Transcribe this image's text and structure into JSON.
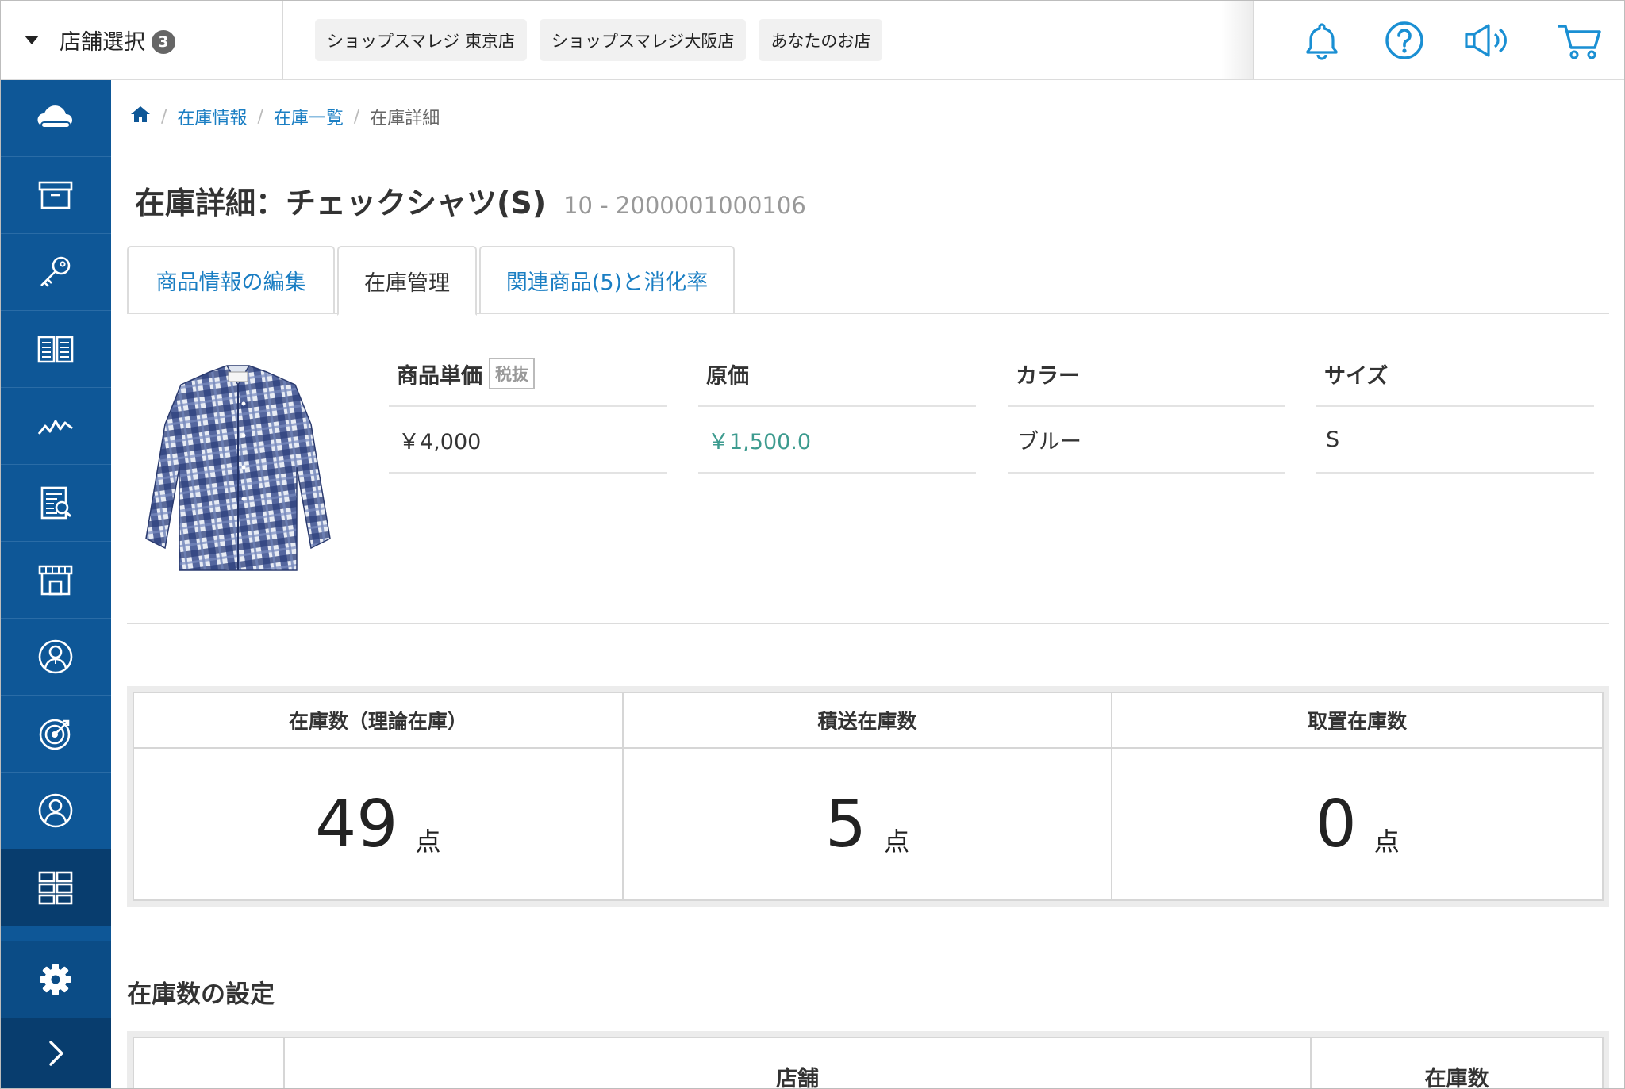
{
  "header": {
    "store_select_label": "店舗選択",
    "store_count": "3",
    "shop_tabs": [
      "ショップスマレジ 東京店",
      "ショップスマレジ大阪店",
      "あなたのお店"
    ],
    "icons": [
      "bell-icon",
      "help-icon",
      "megaphone-icon",
      "cart-icon"
    ]
  },
  "sidebar": {
    "icons": [
      "cloud-icon",
      "archive-box-icon",
      "key-icon",
      "book-icon",
      "line-chart-icon",
      "report-icon",
      "store-icon",
      "user-circle-icon",
      "target-icon",
      "member-icon",
      "inventory-grid-icon",
      "gear-icon",
      "chevron-right-icon"
    ],
    "active_item": "inventory-grid-icon"
  },
  "breadcrumb": {
    "home_icon": "home-icon",
    "items": [
      "在庫情報",
      "在庫一覧"
    ],
    "current": "在庫詳細"
  },
  "page": {
    "title": "在庫詳細：チェックシャツ(S)",
    "code": "10 - 2000001000106"
  },
  "tabs": [
    {
      "label": "商品情報の編集",
      "active": false
    },
    {
      "label": "在庫管理",
      "active": true
    },
    {
      "label": "関連商品(5)と消化率",
      "active": false
    }
  ],
  "product": {
    "image": "plaid-shirt-image",
    "specs": [
      {
        "label": "商品単価",
        "badge": "税抜",
        "value": "￥4,000"
      },
      {
        "label": "原価",
        "badge": "",
        "value": "￥1,500.0"
      },
      {
        "label": "カラー",
        "badge": "",
        "value": "ブルー"
      },
      {
        "label": "サイズ",
        "badge": "",
        "value": "S"
      }
    ]
  },
  "stock_summary": [
    {
      "label": "在庫数（理論在庫）",
      "value": "49",
      "unit": "点"
    },
    {
      "label": "積送在庫数",
      "value": "5",
      "unit": "点"
    },
    {
      "label": "取置在庫数",
      "value": "0",
      "unit": "点"
    }
  ],
  "stock_settings": {
    "title": "在庫数の設定",
    "columns": [
      "",
      "店舗",
      "在庫数"
    ]
  },
  "colors": {
    "sidebar_bg": "#0e5797",
    "sidebar_active": "#083d6e",
    "link": "#1a7ec3",
    "cost_value": "#3d9b8f",
    "icon_blue": "#1a8fd3"
  }
}
